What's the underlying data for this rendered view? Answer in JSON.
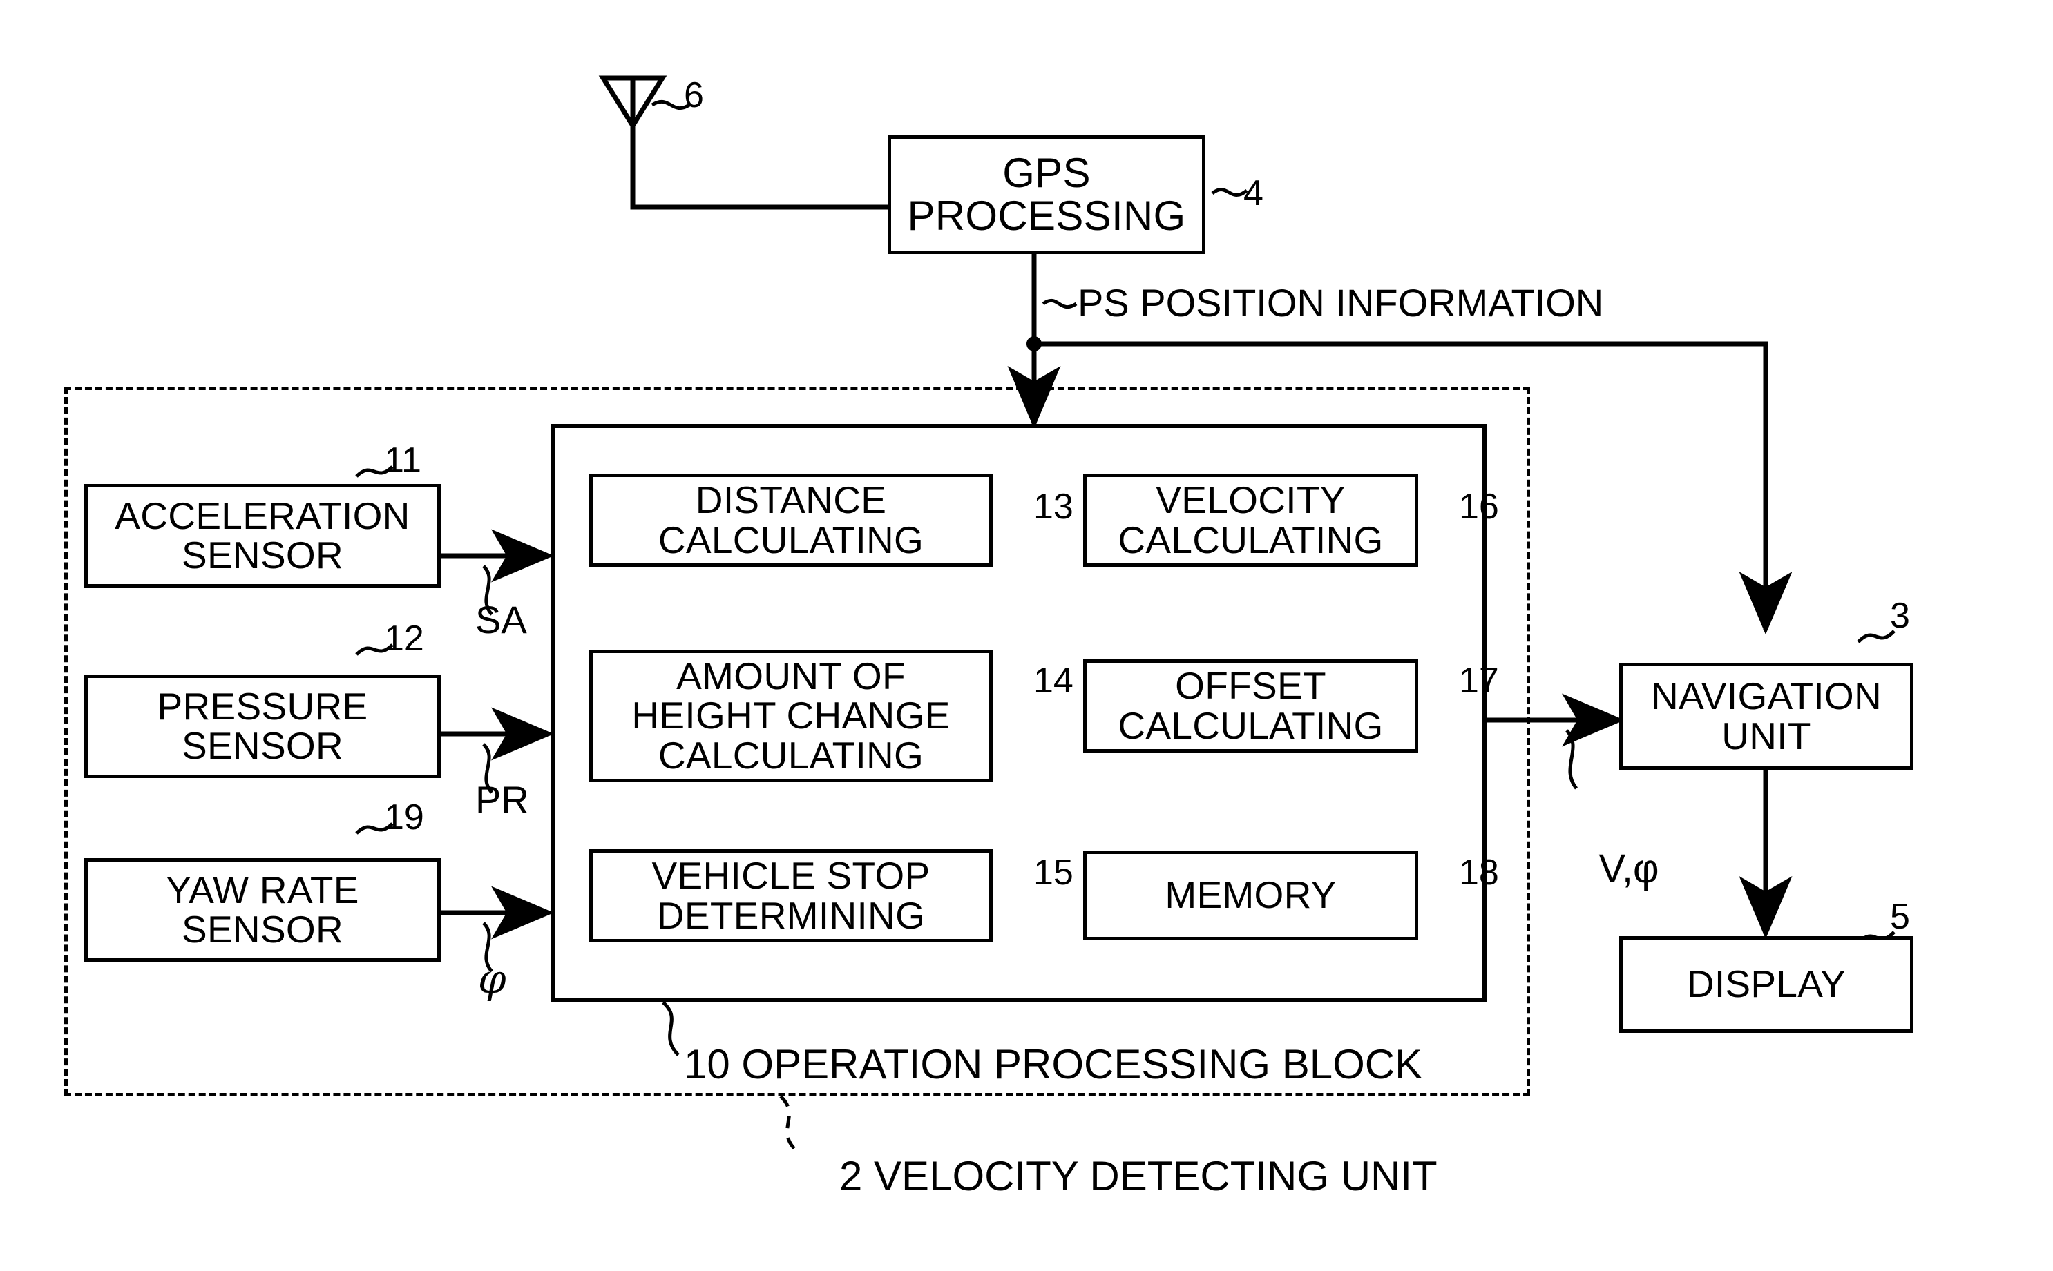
{
  "diagram": {
    "title_note": "Vehicle velocity detecting unit block diagram",
    "antenna_ref": "6",
    "gps": {
      "label": "GPS\nPROCESSING",
      "ref": "4"
    },
    "ps_line_label": "PS POSITION INFORMATION",
    "velocity_detecting_unit": {
      "label": "2 VELOCITY DETECTING UNIT"
    },
    "operation_processing_block": {
      "label": "10 OPERATION PROCESSING BLOCK"
    },
    "sensors": [
      {
        "label": "ACCELERATION\nSENSOR",
        "ref": "11",
        "signal": "SA"
      },
      {
        "label": "PRESSURE\nSENSOR",
        "ref": "12",
        "signal": "PR"
      },
      {
        "label": "YAW RATE\nSENSOR",
        "ref": "19",
        "signal": "φ"
      }
    ],
    "processing_modules_left": [
      {
        "label": "DISTANCE\nCALCULATING",
        "ref": "13"
      },
      {
        "label": "AMOUNT OF\nHEIGHT CHANGE\nCALCULATING",
        "ref": "14"
      },
      {
        "label": "VEHICLE STOP\nDETERMINING",
        "ref": "15"
      }
    ],
    "processing_modules_right": [
      {
        "label": "VELOCITY\nCALCULATING",
        "ref": "16"
      },
      {
        "label": "OFFSET\nCALCULATING",
        "ref": "17"
      },
      {
        "label": "MEMORY",
        "ref": "18"
      }
    ],
    "output_signal_label": "V,φ",
    "navigation": {
      "label": "NAVIGATION\nUNIT",
      "ref": "3"
    },
    "display": {
      "label": "DISPLAY",
      "ref": "5"
    },
    "colors": {
      "stroke": "#000000",
      "background": "#ffffff"
    }
  }
}
